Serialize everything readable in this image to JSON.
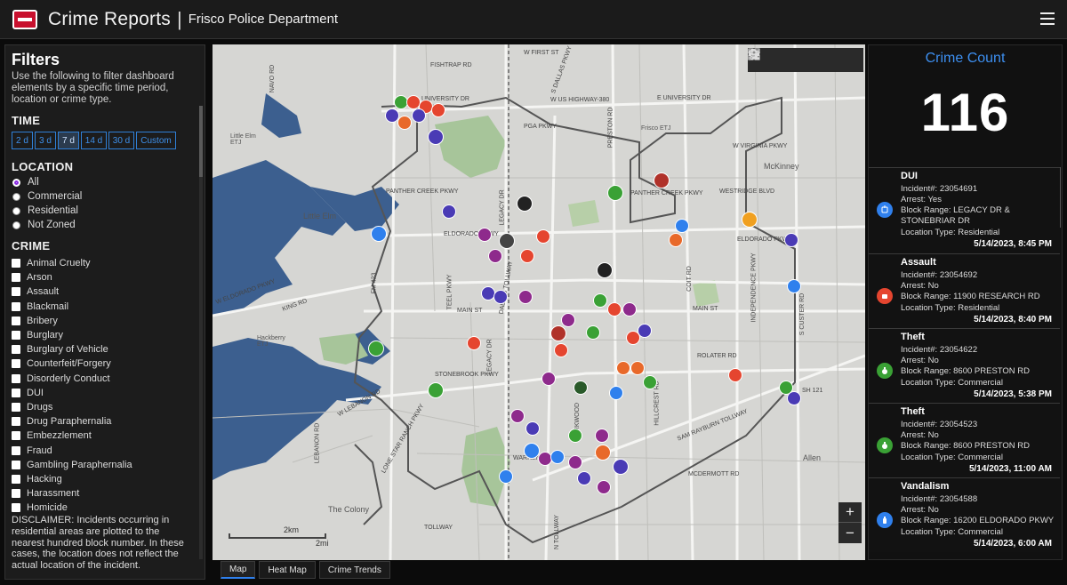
{
  "header": {
    "title": "Crime Reports",
    "separator": "|",
    "department": "Frisco Police Department"
  },
  "filters": {
    "heading": "Filters",
    "intro": "Use the following to filter dashboard elements by a specific time period, location or crime type.",
    "time": {
      "heading": "TIME",
      "options": [
        "2 d",
        "3 d",
        "7 d",
        "14 d",
        "30 d",
        "Custom"
      ],
      "selected": "7 d"
    },
    "location": {
      "heading": "LOCATION",
      "options": [
        "All",
        "Commercial",
        "Residential",
        "Not Zoned"
      ],
      "selected": "All"
    },
    "crime": {
      "heading": "CRIME",
      "options": [
        "Animal Cruelty",
        "Arson",
        "Assault",
        "Blackmail",
        "Bribery",
        "Burglary",
        "Burglary of Vehicle",
        "Counterfeit/Forgery",
        "Disorderly Conduct",
        "DUI",
        "Drugs",
        "Drug Paraphernalia",
        "Embezzlement",
        "Fraud",
        "Gambling Paraphernalia",
        "Hacking",
        "Harassment",
        "Homicide"
      ]
    },
    "disclaimer": "DISCLAIMER: Incidents occurring in residential areas are plotted to the nearest hundred block number. In these cases, the location does not reflect the actual location of the incident."
  },
  "map": {
    "labels": {
      "fishtrap": "FISHTRAP RD",
      "university": "UNIVERSITY DR",
      "us380": "W US HIGHWAY-380",
      "eunivdr": "E UNIVERSITY DR",
      "wfirst": "W FIRST ST",
      "sdallas": "S DALLAS PKWY",
      "pga": "PGA PKWY",
      "panther": "PANTHER CREEK PKWY",
      "wpanther": "PANTHER CREEK PKWY",
      "westridge": "WESTRIDGE BLVD",
      "eldorado": "ELDORADO PKWY",
      "eldorado2": "ELDORADO PKWY",
      "weldorado": "W ELDORADO PKWY",
      "main": "MAIN ST",
      "main2": "MAIN ST",
      "stonebrook": "STONEBROOK PKWY",
      "rolater": "ROLATER RD",
      "samrayburn": "SAM RAYBURN TOLLWAY",
      "mcdermott": "MCDERMOTT RD",
      "wvirginia": "W VIRGINIA PKWY",
      "mckinney": "McKinney",
      "little_elm": "Little Elm",
      "hackberry": "Hackberry ETJ",
      "colony": "The Colony",
      "allen": "Allen",
      "frisco_etj": "Frisco ETJ",
      "little_elm_etj": "Little Elm ETJ",
      "fm423": "FM 423",
      "sh121": "SH 121",
      "wlebanon": "W LEBANON RD",
      "lebanon": "LEBANON RD",
      "lonestar": "LONE STAR RANCH PKWY",
      "teel": "TEEL PKWY",
      "legacy": "LEGACY DR",
      "legacy2": "LEGACY DR",
      "preston": "PRESTON RD",
      "coit": "COIT RD",
      "independence": "INDEPENDENCE PKWY",
      "custer": "S CUSTER RD",
      "hillcrest": "HILLCREST RD",
      "tollway": "TOLLWAY",
      "navo": "NAVO RD",
      "kingrd": "KING RD",
      "warren": "WARREN PKWY",
      "parkwood": "PARKWOOD",
      "n_tollway": "N TOLLWAY",
      "dallas_tollway": "DALLAS TOLLWAY"
    },
    "scale": {
      "km": "2km",
      "mi": "2mi"
    },
    "zoom_in": "+",
    "zoom_out": "−"
  },
  "tabs": [
    "Map",
    "Heat Map",
    "Crime Trends"
  ],
  "active_tab": "Map",
  "summary": {
    "title": "Crime Count",
    "count": "116"
  },
  "incidents": [
    {
      "type": "DUI",
      "incident": "Incident#: 23054691",
      "arrest": "Arrest: Yes",
      "block": [
        "Block Range: LEGACY DR &",
        "STONEBRIAR DR"
      ],
      "location": "Location Type: Residential",
      "date": "5/14/2023, 8:45 PM",
      "color": "#2f80ed",
      "icon": "dui-icon"
    },
    {
      "type": "Assault",
      "incident": "Incident#: 23054692",
      "arrest": "Arrest: No",
      "block": [
        "Block Range: 11900 RESEARCH RD"
      ],
      "location": "Location Type: Residential",
      "date": "5/14/2023, 8:40 PM",
      "color": "#e5452f",
      "icon": "fist-icon"
    },
    {
      "type": "Theft",
      "incident": "Incident#: 23054622",
      "arrest": "Arrest: No",
      "block": [
        "Block Range: 8600 PRESTON RD"
      ],
      "location": "Location Type: Commercial",
      "date": "5/14/2023, 5:38 PM",
      "color": "#3aa135",
      "icon": "money-bag-icon"
    },
    {
      "type": "Theft",
      "incident": "Incident#: 23054523",
      "arrest": "Arrest: No",
      "block": [
        "Block Range: 8600 PRESTON RD"
      ],
      "location": "Location Type: Commercial",
      "date": "5/14/2023, 11:00 AM",
      "color": "#3aa135",
      "icon": "money-bag-icon"
    },
    {
      "type": "Vandalism",
      "incident": "Incident#: 23054588",
      "arrest": "Arrest: No",
      "block": [
        "Block Range: 16200 ELDORADO PKWY"
      ],
      "location": "Location Type: Commercial",
      "date": "5/14/2023, 6:00 AM",
      "color": "#2f80ed",
      "icon": "spray-can-icon"
    }
  ],
  "colors": {
    "accent": "#3d8ff0",
    "theft": "#3aa135",
    "assault": "#e5452f",
    "drugs": "#8e2a8c",
    "burglary": "#4a3bb5",
    "fraud": "#e8692a",
    "dui": "#2f80ed",
    "robbery": "#222222",
    "warning": "#f0a020"
  }
}
